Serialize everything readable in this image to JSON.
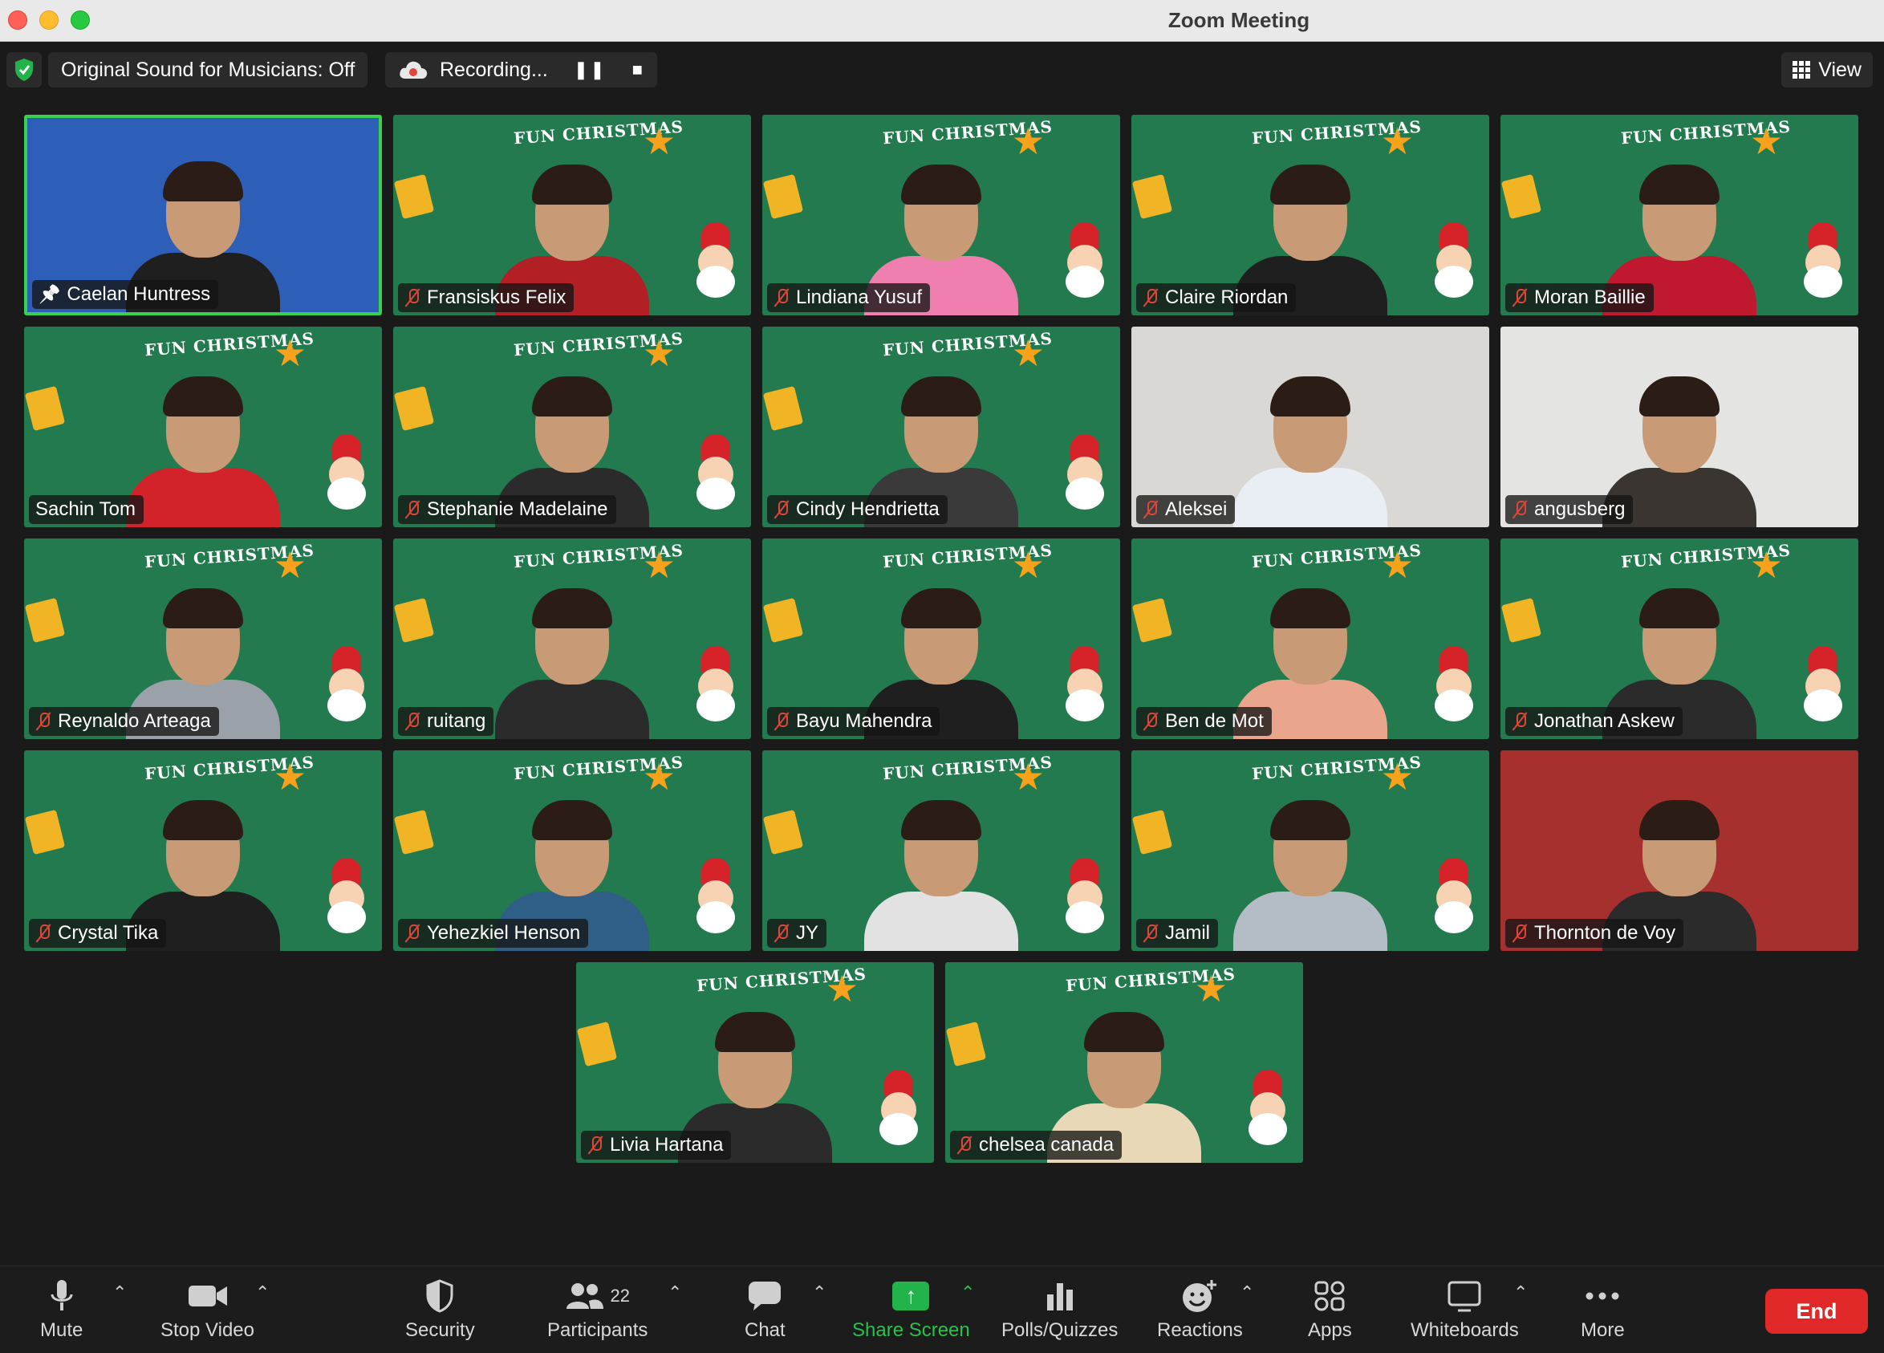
{
  "window": {
    "title": "Zoom Meeting"
  },
  "topbar": {
    "original_sound": "Original Sound for Musicians: Off",
    "recording": "Recording...",
    "view_label": "View"
  },
  "tile_theme_text": "FUN CHRISTMAS",
  "participants": [
    {
      "name": "Caelan Huntress",
      "muted": false,
      "pinned": true,
      "background": "#2e5fb8",
      "shirt": "#1f1f1f"
    },
    {
      "name": "Fransiskus Felix",
      "muted": true,
      "background": "#237a4f",
      "shirt": "#b21f24"
    },
    {
      "name": "Lindiana Yusuf",
      "muted": true,
      "background": "#237a4f",
      "shirt": "#ee7fae"
    },
    {
      "name": "Claire Riordan",
      "muted": true,
      "background": "#237a4f",
      "shirt": "#1f1f1f"
    },
    {
      "name": "Moran Baillie",
      "muted": true,
      "background": "#237a4f",
      "shirt": "#c0182e"
    },
    {
      "name": "Sachin Tom",
      "muted": false,
      "background": "#237a4f",
      "shirt": "#d2232a"
    },
    {
      "name": "Stephanie Madelaine",
      "muted": true,
      "background": "#237a4f",
      "shirt": "#2b2b2b"
    },
    {
      "name": "Cindy Hendrietta",
      "muted": true,
      "background": "#237a4f",
      "shirt": "#3a3a3a"
    },
    {
      "name": "Aleksei",
      "muted": true,
      "background": "#d9d8d4",
      "shirt": "#e9eef4"
    },
    {
      "name": "angusberg",
      "muted": true,
      "background": "#e4e4e2",
      "shirt": "#3a3530"
    },
    {
      "name": "Reynaldo Arteaga",
      "muted": true,
      "background": "#237a4f",
      "shirt": "#9aa1a8"
    },
    {
      "name": "ruitang",
      "muted": true,
      "background": "#237a4f",
      "shirt": "#2b2b2b"
    },
    {
      "name": "Bayu Mahendra",
      "muted": true,
      "background": "#237a4f",
      "shirt": "#1f1f1f"
    },
    {
      "name": "Ben de Mot",
      "muted": true,
      "background": "#237a4f",
      "shirt": "#e9a68c"
    },
    {
      "name": "Jonathan Askew",
      "muted": true,
      "background": "#237a4f",
      "shirt": "#2b2b2b"
    },
    {
      "name": "Crystal Tika",
      "muted": true,
      "background": "#237a4f",
      "shirt": "#1f1f1f"
    },
    {
      "name": "Yehezkiel Henson",
      "muted": true,
      "background": "#237a4f",
      "shirt": "#2f5f86"
    },
    {
      "name": "JY",
      "muted": true,
      "background": "#237a4f",
      "shirt": "#e2e2e2"
    },
    {
      "name": "Jamil",
      "muted": true,
      "background": "#237a4f",
      "shirt": "#b4bcc6"
    },
    {
      "name": "Thornton de Voy",
      "muted": true,
      "background": "#a5302e",
      "shirt": "#2b2b2b"
    },
    {
      "name": "Livia Hartana",
      "muted": true,
      "background": "#237a4f",
      "shirt": "#2b2b2b"
    },
    {
      "name": "chelsea canada",
      "muted": true,
      "background": "#237a4f",
      "shirt": "#e9d8b8"
    }
  ],
  "toolbar": {
    "mute": "Mute",
    "stop_video": "Stop Video",
    "security": "Security",
    "participants": "Participants",
    "participants_count": "22",
    "chat": "Chat",
    "share_screen": "Share Screen",
    "polls": "Polls/Quizzes",
    "reactions": "Reactions",
    "apps": "Apps",
    "whiteboards": "Whiteboards",
    "more": "More",
    "end": "End"
  },
  "colors": {
    "active_speaker_border": "#36d14f",
    "share_green": "#22b34a",
    "end_red": "#e02828",
    "muted_mic_red": "#e0453a"
  }
}
